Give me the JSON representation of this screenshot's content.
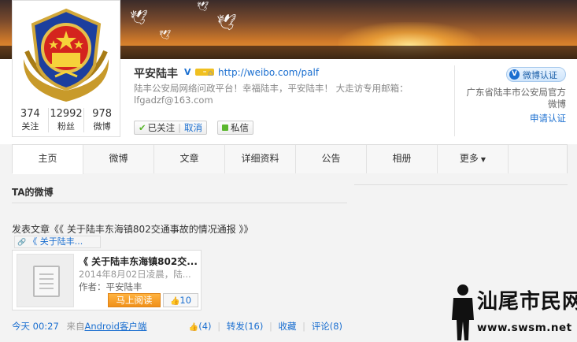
{
  "profile": {
    "name": "平安陆丰",
    "url": "http://weibo.com/palf",
    "description": "陆丰公安局网络问政平台！幸福陆丰，平安陆丰！ 大走访专用邮箱：lfgadzf@163.com",
    "counts": [
      {
        "num": "374",
        "label": "关注"
      },
      {
        "num": "12992",
        "label": "粉丝"
      },
      {
        "num": "978",
        "label": "微博"
      }
    ],
    "follow_label": "已关注",
    "unfollow_label": "取消",
    "message_label": "私信",
    "verify_badge": "微博认证",
    "verify_text": "广东省陆丰市公安局官方微博",
    "apply_verify": "申请认证"
  },
  "tabs": [
    "主页",
    "微博",
    "文章",
    "详细资料",
    "公告",
    "相册",
    "更多"
  ],
  "feed": {
    "section_title": "TA的微博",
    "post_text": "发表文章《《 关于陆丰东海镇802交通事故的情况通报 》》",
    "link_pill": "《 关于陆丰...",
    "card": {
      "title": "《 关于陆丰东海镇802交...",
      "date": "2014年8月02日凌晨，陆...",
      "author": "作者：平安陆丰",
      "read_button": "马上阅读",
      "like_count": "10"
    },
    "meta": {
      "time": "今天 00:27",
      "source_prefix": "来自",
      "source": "Android客户端",
      "likes": "(4)",
      "repost": "转发(16)",
      "favorite": "收藏",
      "comment": "评论(8)"
    }
  },
  "watermark": {
    "title": "汕尾市民网",
    "site": "www.swsm.net"
  },
  "colors": {
    "link": "#1b6fd0",
    "read_button": "#f0901a"
  }
}
